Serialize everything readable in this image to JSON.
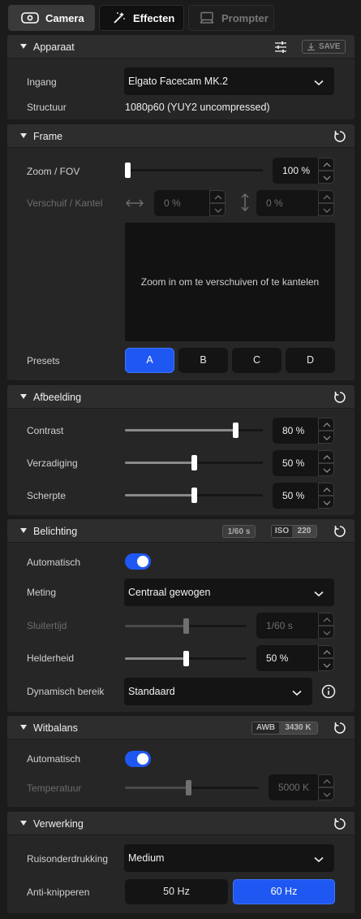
{
  "tabs": [
    {
      "label": "Camera",
      "icon": "camera-icon",
      "active": true
    },
    {
      "label": "Effecten",
      "icon": "magic-wand-icon",
      "active": false
    },
    {
      "label": "Prompter",
      "icon": "prompter-icon",
      "active": false
    }
  ],
  "colors": {
    "accent": "#1f57f2",
    "panel": "#262626",
    "header": "#2d2d2d",
    "field": "#141414"
  },
  "apparaat": {
    "title": "Apparaat",
    "save_label": "SAVE",
    "input_label": "Ingang",
    "input_value": "Elgato Facecam MK.2",
    "format_label": "Structuur",
    "format_value": "1080p60 (YUY2 uncompressed)"
  },
  "frame": {
    "title": "Frame",
    "zoom_label": "Zoom / FOV",
    "zoom_value": "100 %",
    "zoom_level": 0,
    "pan_label": "Verschuif / Kantel",
    "pan_value": "0 %",
    "tilt_value": "0 %",
    "preview_text": "Zoom in om te verschuiven of te kantelen",
    "presets_label": "Presets",
    "presets": [
      "A",
      "B",
      "C",
      "D"
    ],
    "active_preset": "A"
  },
  "afbeelding": {
    "title": "Afbeelding",
    "contrast_label": "Contrast",
    "contrast_value": "80 %",
    "contrast_level": 0.8,
    "saturation_label": "Verzadiging",
    "saturation_value": "50 %",
    "saturation_level": 0.5,
    "sharpness_label": "Scherpte",
    "sharpness_value": "50 %",
    "sharpness_level": 0.5
  },
  "belichting": {
    "title": "Belichting",
    "badge_shutter": "1/60 s",
    "badge_iso_label": "ISO",
    "badge_iso_value": "220",
    "auto_label": "Automatisch",
    "auto_on": true,
    "metering_label": "Meting",
    "metering_value": "Centraal gewogen",
    "shutter_label": "Sluitertijd",
    "shutter_value": "1/60 s",
    "shutter_level": 0.5,
    "brightness_label": "Helderheid",
    "brightness_value": "50 %",
    "brightness_level": 0.5,
    "dynamic_label": "Dynamisch bereik",
    "dynamic_value": "Standaard"
  },
  "witbalans": {
    "title": "Witbalans",
    "badge_awb_label": "AWB",
    "badge_awb_value": "3430 K",
    "auto_label": "Automatisch",
    "auto_on": true,
    "temp_label": "Temperatuur",
    "temp_value": "5000 K",
    "temp_level": 0.47
  },
  "verwerking": {
    "title": "Verwerking",
    "noise_label": "Ruisonderdrukking",
    "noise_value": "Medium",
    "flicker_label": "Anti-knipperen",
    "flicker_options": [
      "50 Hz",
      "60 Hz"
    ],
    "flicker_active": "60 Hz"
  }
}
